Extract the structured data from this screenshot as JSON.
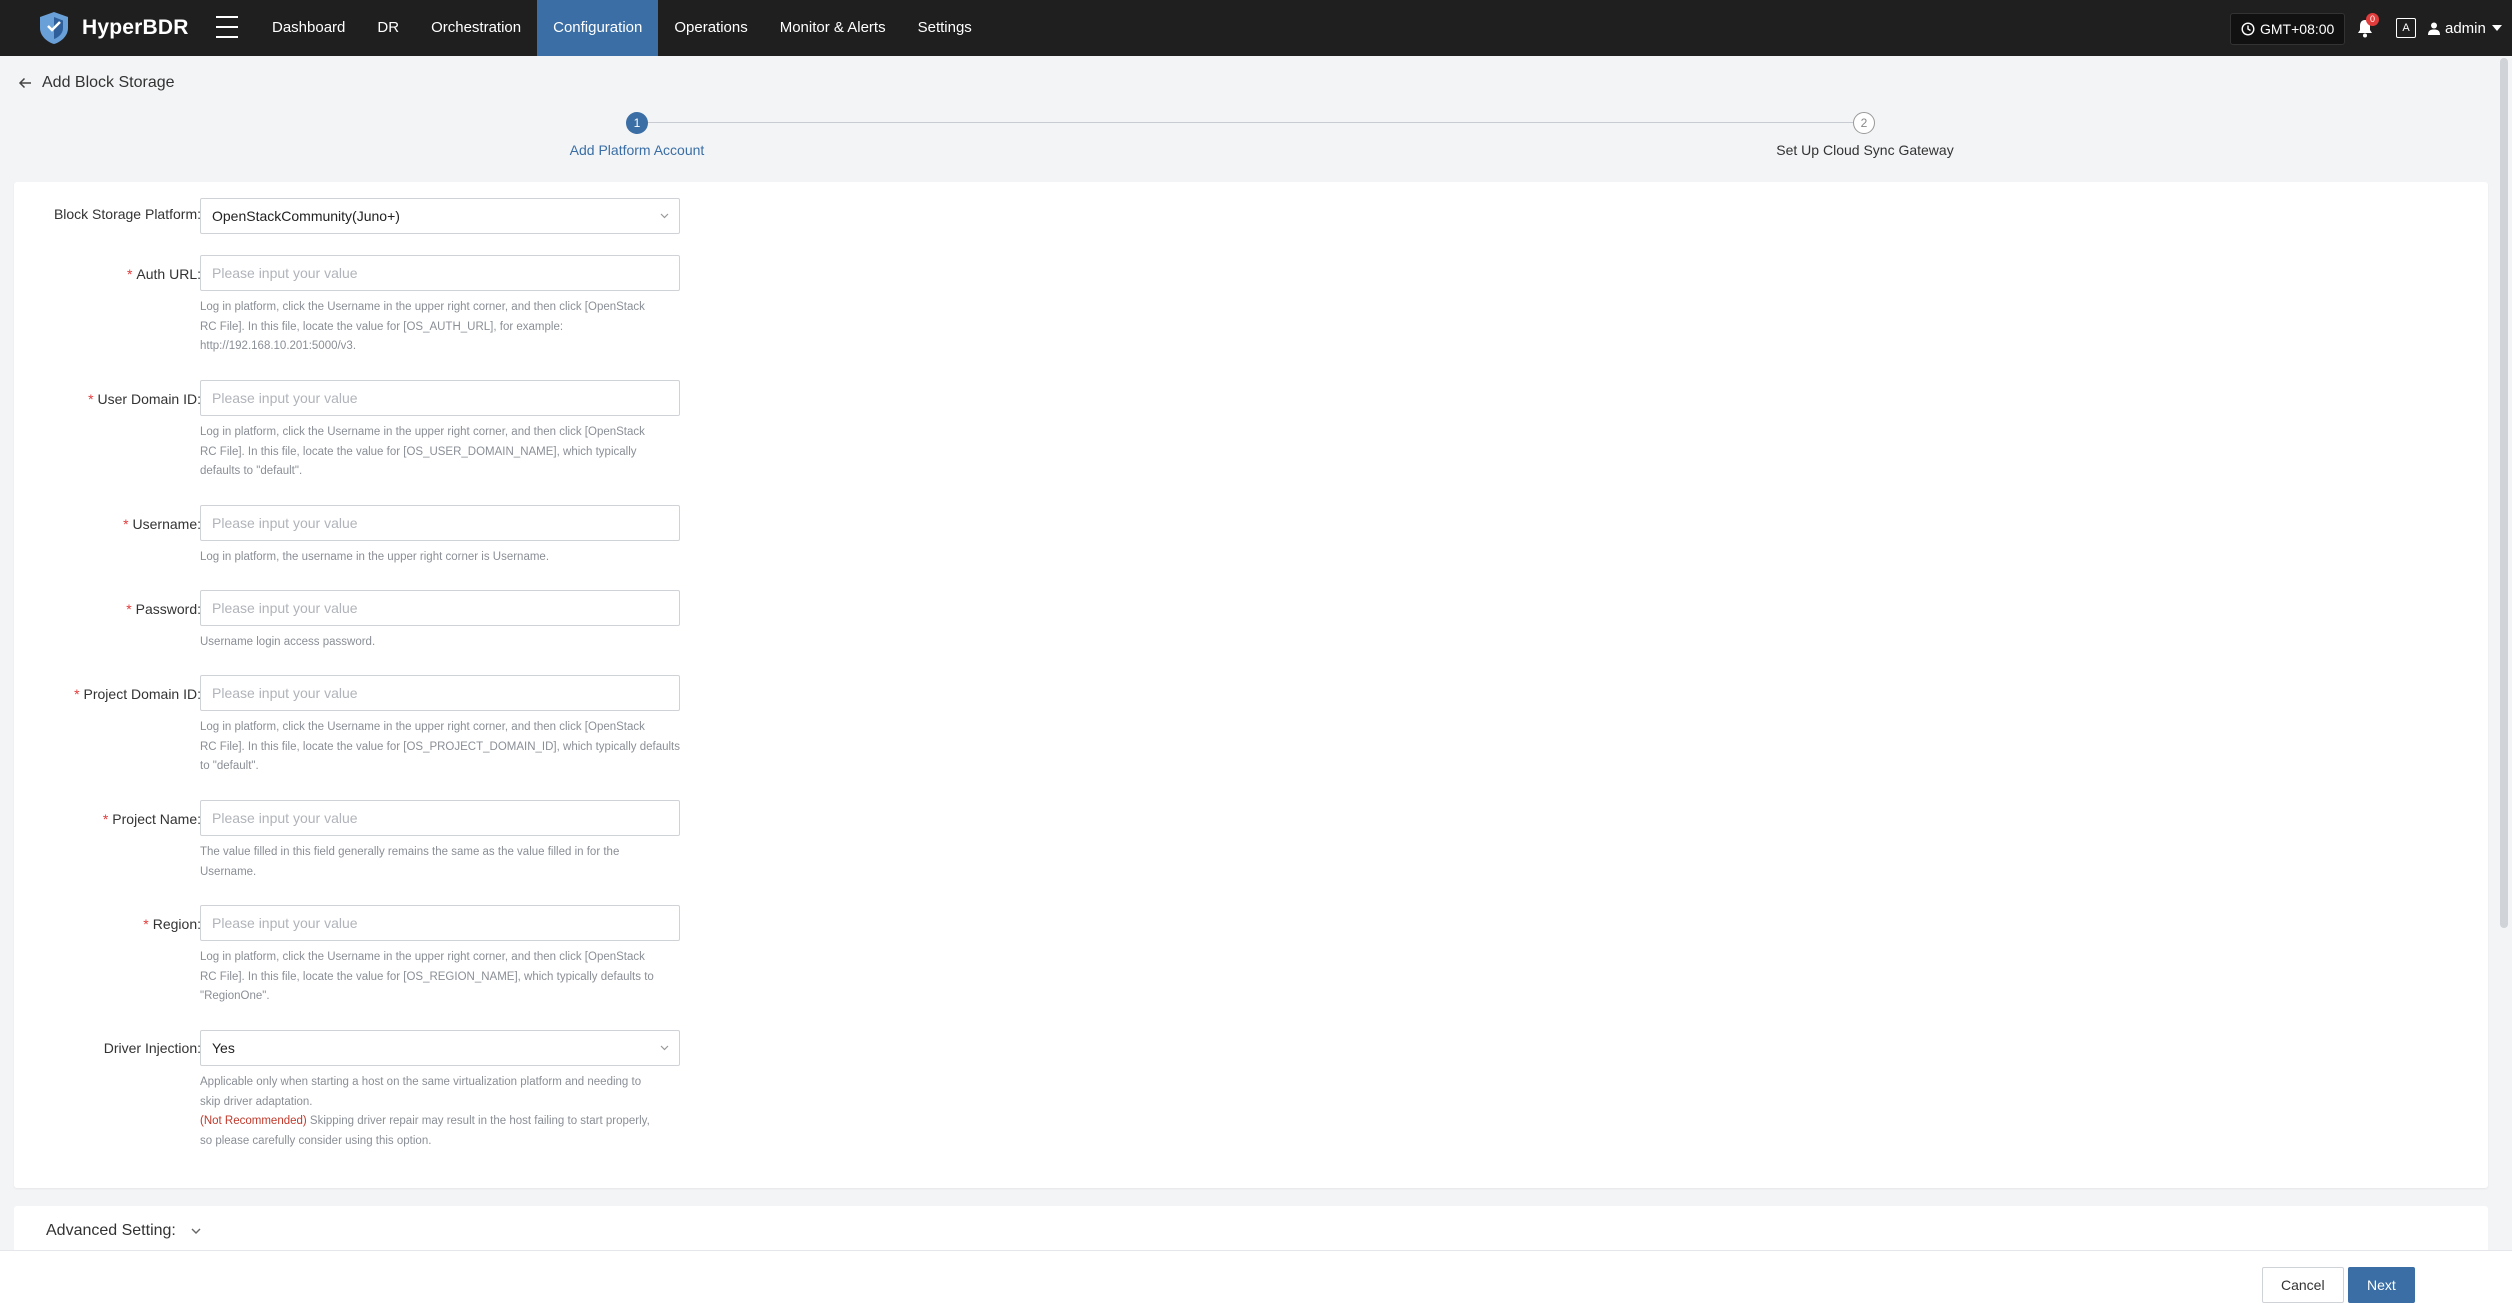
{
  "app": {
    "name": "HyperBDR"
  },
  "nav": {
    "items": [
      {
        "label": "Dashboard",
        "active": false
      },
      {
        "label": "DR",
        "active": false
      },
      {
        "label": "Orchestration",
        "active": false
      },
      {
        "label": "Configuration",
        "active": true
      },
      {
        "label": "Operations",
        "active": false
      },
      {
        "label": "Monitor & Alerts",
        "active": false
      },
      {
        "label": "Settings",
        "active": false
      }
    ]
  },
  "header": {
    "timezone": "GMT+08:00",
    "notification_count": "0",
    "lang_icon_text": "A",
    "user": "admin"
  },
  "page": {
    "title": "Add Block Storage"
  },
  "steps": [
    {
      "num": "1",
      "label": "Add Platform Account",
      "state": "active"
    },
    {
      "num": "2",
      "label": "Set Up Cloud Sync Gateway",
      "state": "pending"
    }
  ],
  "form": {
    "platform": {
      "label": "Block Storage Platform:",
      "value": "OpenStackCommunity(Juno+)"
    },
    "auth_url": {
      "label": "Auth URL:",
      "placeholder": "Please input your value",
      "hint_1": "Log in platform, click the Username in the upper right corner, and then click [OpenStack",
      "hint_2": "RC File]. In this file, locate the value for [OS_AUTH_URL], for example:",
      "hint_3": "http://192.168.10.201:5000/v3."
    },
    "user_domain_id": {
      "label": "User Domain ID:",
      "placeholder": "Please input your value",
      "hint_1": "Log in platform, click the Username in the upper right corner, and then click [OpenStack",
      "hint_2": "RC File]. In this file, locate the value for [OS_USER_DOMAIN_NAME], which typically",
      "hint_3": "defaults to \"default\"."
    },
    "username": {
      "label": "Username:",
      "placeholder": "Please input your value",
      "hint_1": "Log in platform, the username in the upper right corner is Username."
    },
    "password": {
      "label": "Password:",
      "placeholder": "Please input your value",
      "hint_1": "Username login access password."
    },
    "project_domain_id": {
      "label": "Project Domain ID:",
      "placeholder": "Please input your value",
      "hint_1": "Log in platform, click the Username in the upper right corner, and then click [OpenStack",
      "hint_2": "RC File]. In this file, locate the value for [OS_PROJECT_DOMAIN_ID], which typically defaults",
      "hint_3": "to \"default\"."
    },
    "project_name": {
      "label": "Project Name:",
      "placeholder": "Please input your value",
      "hint_1": "The value filled in this field generally remains the same as the value filled in for the",
      "hint_2": "Username."
    },
    "region": {
      "label": "Region:",
      "placeholder": "Please input your value",
      "hint_1": "Log in platform, click the Username in the upper right corner, and then click [OpenStack",
      "hint_2": "RC File]. In this file, locate the value for [OS_REGION_NAME], which typically defaults to",
      "hint_3": "\"RegionOne\"."
    },
    "driver_injection": {
      "label": "Driver Injection:",
      "value": "Yes",
      "hint_1": "Applicable only when starting a host on the same virtualization platform and needing to",
      "hint_2": "skip driver adaptation.",
      "hint_warn": "(Not Recommended)",
      "hint_3": " Skipping driver repair may result in the host failing to start properly,",
      "hint_4": "so please carefully consider using this option."
    }
  },
  "advanced": {
    "label": "Advanced Setting:"
  },
  "footer": {
    "cancel": "Cancel",
    "next": "Next"
  },
  "colors": {
    "topbar": "#1f1f1f",
    "accent": "#3a6ea5",
    "required": "#e23b3b",
    "warning": "#c0392b"
  }
}
